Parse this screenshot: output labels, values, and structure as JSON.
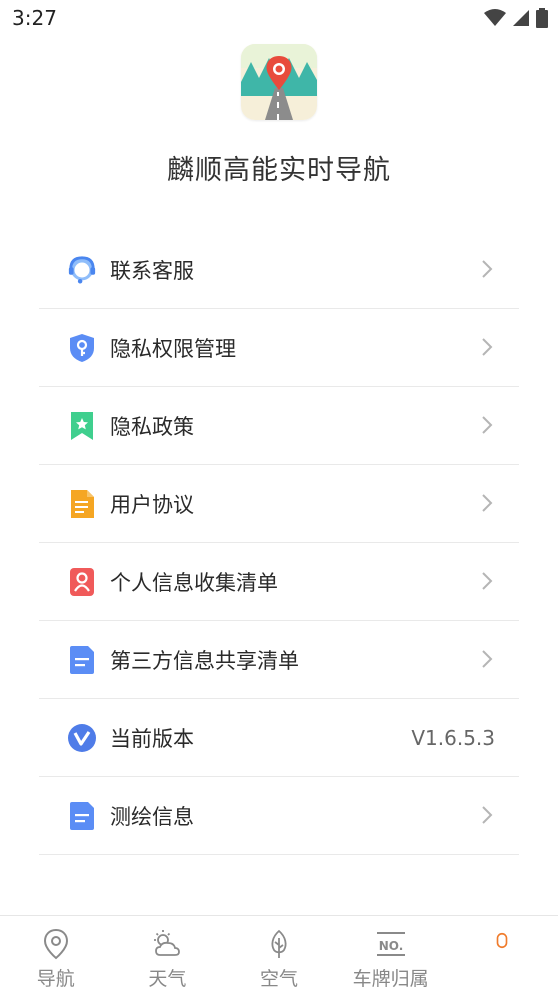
{
  "status_bar": {
    "time": "3:27"
  },
  "app": {
    "title": "麟顺高能实时导航"
  },
  "menu": {
    "items": [
      {
        "label": "联系客服",
        "icon": "customer-service-icon",
        "chevron": true
      },
      {
        "label": "隐私权限管理",
        "icon": "privacy-permission-icon",
        "chevron": true
      },
      {
        "label": "隐私政策",
        "icon": "privacy-policy-icon",
        "chevron": true
      },
      {
        "label": "用户协议",
        "icon": "user-agreement-icon",
        "chevron": true
      },
      {
        "label": "个人信息收集清单",
        "icon": "personal-info-icon",
        "chevron": true
      },
      {
        "label": "第三方信息共享清单",
        "icon": "third-party-info-icon",
        "chevron": true
      },
      {
        "label": "当前版本",
        "icon": "version-icon",
        "value": "V1.6.5.3"
      },
      {
        "label": "测绘信息",
        "icon": "mapping-info-icon",
        "chevron": true
      }
    ]
  },
  "tabs": [
    {
      "label": "导航",
      "icon": "location-pin-icon"
    },
    {
      "label": "天气",
      "icon": "weather-icon"
    },
    {
      "label": "空气",
      "icon": "leaf-icon"
    },
    {
      "label": "车牌归属",
      "icon": "license-plate-icon"
    },
    {
      "label": "",
      "icon": "profile-icon",
      "active": true
    }
  ],
  "colors": {
    "accent": "#f07b2b",
    "inactive_tab": "#888888",
    "blue_icon": "#5b8df5",
    "green_icon": "#3fcf8e",
    "orange_icon": "#f5a623",
    "red_icon": "#f05a5a"
  }
}
